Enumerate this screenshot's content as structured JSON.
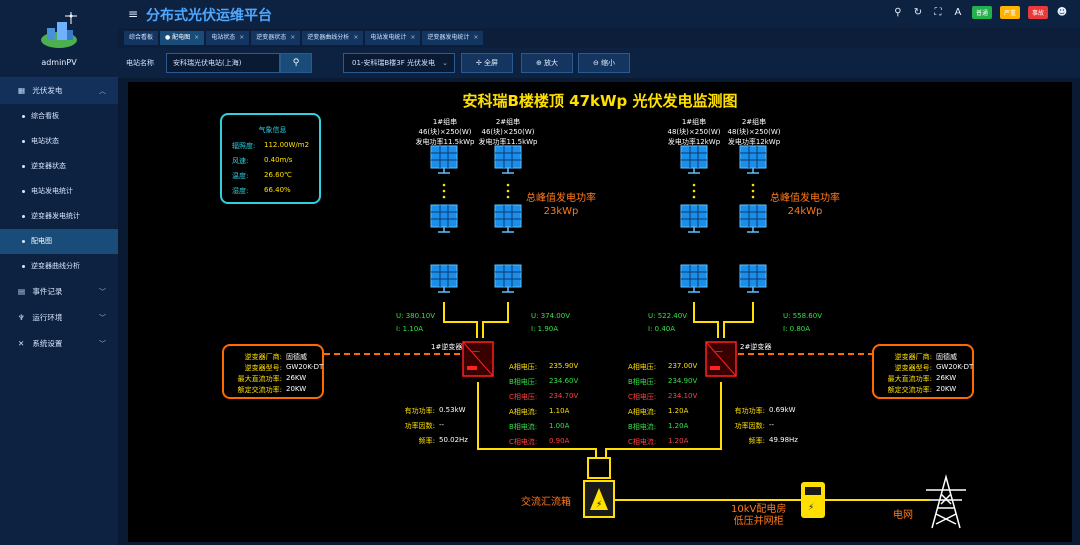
{
  "user": {
    "name": "adminPV"
  },
  "app_title": "分布式光伏运维平台",
  "top_badges": [
    {
      "label": "普通",
      "color": "#22b14c"
    },
    {
      "label": "严重",
      "color": "#ffb300"
    },
    {
      "label": "事故",
      "color": "#e83a3a"
    }
  ],
  "sidebar": {
    "groups": [
      {
        "label": "光伏发电",
        "icon": "grid-icon",
        "chevron": "︿"
      },
      {
        "label": "事件记录",
        "icon": "calendar-icon",
        "chevron": "﹀"
      },
      {
        "label": "运行环境",
        "icon": "tool-icon",
        "chevron": "﹀"
      },
      {
        "label": "系统设置",
        "icon": "wrench-icon",
        "chevron": "﹀"
      }
    ],
    "sub_items": [
      "综合看板",
      "电站状态",
      "逆变器状态",
      "电站发电统计",
      "逆变器发电统计",
      "配电图",
      "逆变器曲线分析"
    ],
    "active_sub": "配电图"
  },
  "tabs": [
    {
      "label": "综合看板",
      "active": false
    },
    {
      "label": "● 配电图",
      "active": true
    },
    {
      "label": "电站状态",
      "active": false
    },
    {
      "label": "逆变器状态",
      "active": false
    },
    {
      "label": "逆变器曲线分析",
      "active": false
    },
    {
      "label": "电站发电统计",
      "active": false
    },
    {
      "label": "逆变器发电统计",
      "active": false
    }
  ],
  "filter": {
    "station_label": "电站名称",
    "station_value": "安科瑞光伏电站(上海)",
    "select_value": "01-安科瑞B楼3F 光伏发电",
    "fullscreen_label": "全屏",
    "zoom_in_label": "放大",
    "zoom_out_label": "缩小"
  },
  "diagram": {
    "title": "安科瑞B楼楼顶 47kWp 光伏发电监测图",
    "weather": {
      "title": "气象信息",
      "rows": [
        {
          "label": "辐照度:",
          "value": "112.00W/m2"
        },
        {
          "label": "风速:",
          "value": "0.40m/s"
        },
        {
          "label": "温度:",
          "value": "26.60℃"
        },
        {
          "label": "湿度:",
          "value": "66.40%"
        }
      ]
    },
    "strings": [
      {
        "name": "1#组串",
        "spec": "46(块)×250(W)",
        "power": "发电功率11.5kWp"
      },
      {
        "name": "2#组串",
        "spec": "46(块)×250(W)",
        "power": "发电功率11.5kWp"
      },
      {
        "name": "1#组串",
        "spec": "48(块)×250(W)",
        "power": "发电功率12kWp"
      },
      {
        "name": "2#组串",
        "spec": "48(块)×250(W)",
        "power": "发电功率12kWp"
      }
    ],
    "peak_left": {
      "label": "总峰值发电功率",
      "value": "23kWp"
    },
    "peak_right": {
      "label": "总峰值发电功率",
      "value": "24kWp"
    },
    "string_readings": [
      {
        "u": "U: 380.10V",
        "i": "I: 1.10A"
      },
      {
        "u": "U: 374.00V",
        "i": "I: 1.90A"
      },
      {
        "u": "U: 522.40V",
        "i": "I: 0.40A"
      },
      {
        "u": "U: 558.60V",
        "i": "I: 0.80A"
      }
    ],
    "inverter1": {
      "name": "1#逆变器",
      "info": [
        {
          "label": "逆变器厂商:",
          "value": "固德威"
        },
        {
          "label": "逆变器型号:",
          "value": "GW20K-DT"
        },
        {
          "label": "最大直流功率:",
          "value": "26KW"
        },
        {
          "label": "额定交流功率:",
          "value": "20KW"
        }
      ],
      "power": [
        {
          "label": "有功功率:",
          "value": "0.53kW"
        },
        {
          "label": "功率因数:",
          "value": "--"
        },
        {
          "label": "频率:",
          "value": "50.02Hz"
        }
      ],
      "phases": [
        {
          "label": "A相电压:",
          "value": "235.90V",
          "color": "#ffe000"
        },
        {
          "label": "B相电压:",
          "value": "234.60V",
          "color": "#37e04a"
        },
        {
          "label": "C相电压:",
          "value": "234.70V",
          "color": "#ff4040"
        },
        {
          "label": "A相电流:",
          "value": "1.10A",
          "color": "#ffe000"
        },
        {
          "label": "B相电流:",
          "value": "1.00A",
          "color": "#37e04a"
        },
        {
          "label": "C相电流:",
          "value": "0.90A",
          "color": "#ff4040"
        }
      ]
    },
    "inverter2": {
      "name": "2#逆变器",
      "info": [
        {
          "label": "逆变器厂商:",
          "value": "固德威"
        },
        {
          "label": "逆变器型号:",
          "value": "GW20K-DT"
        },
        {
          "label": "最大直流功率:",
          "value": "26KW"
        },
        {
          "label": "额定交流功率:",
          "value": "20KW"
        }
      ],
      "power": [
        {
          "label": "有功功率:",
          "value": "0.69kW"
        },
        {
          "label": "功率因数:",
          "value": "--"
        },
        {
          "label": "频率:",
          "value": "49.98Hz"
        }
      ],
      "phases": [
        {
          "label": "A相电压:",
          "value": "237.00V",
          "color": "#ffe000"
        },
        {
          "label": "B相电压:",
          "value": "234.90V",
          "color": "#37e04a"
        },
        {
          "label": "C相电压:",
          "value": "234.10V",
          "color": "#ff4040"
        },
        {
          "label": "A相电流:",
          "value": "1.20A",
          "color": "#ffe000"
        },
        {
          "label": "B相电流:",
          "value": "1.20A",
          "color": "#37e04a"
        },
        {
          "label": "C相电流:",
          "value": "1.20A",
          "color": "#ff4040"
        }
      ]
    },
    "combiner_label": "交流汇流箱",
    "switchgear_label_1": "10kV配电房",
    "switchgear_label_2": "低压并网柜",
    "grid_label": "电网"
  }
}
